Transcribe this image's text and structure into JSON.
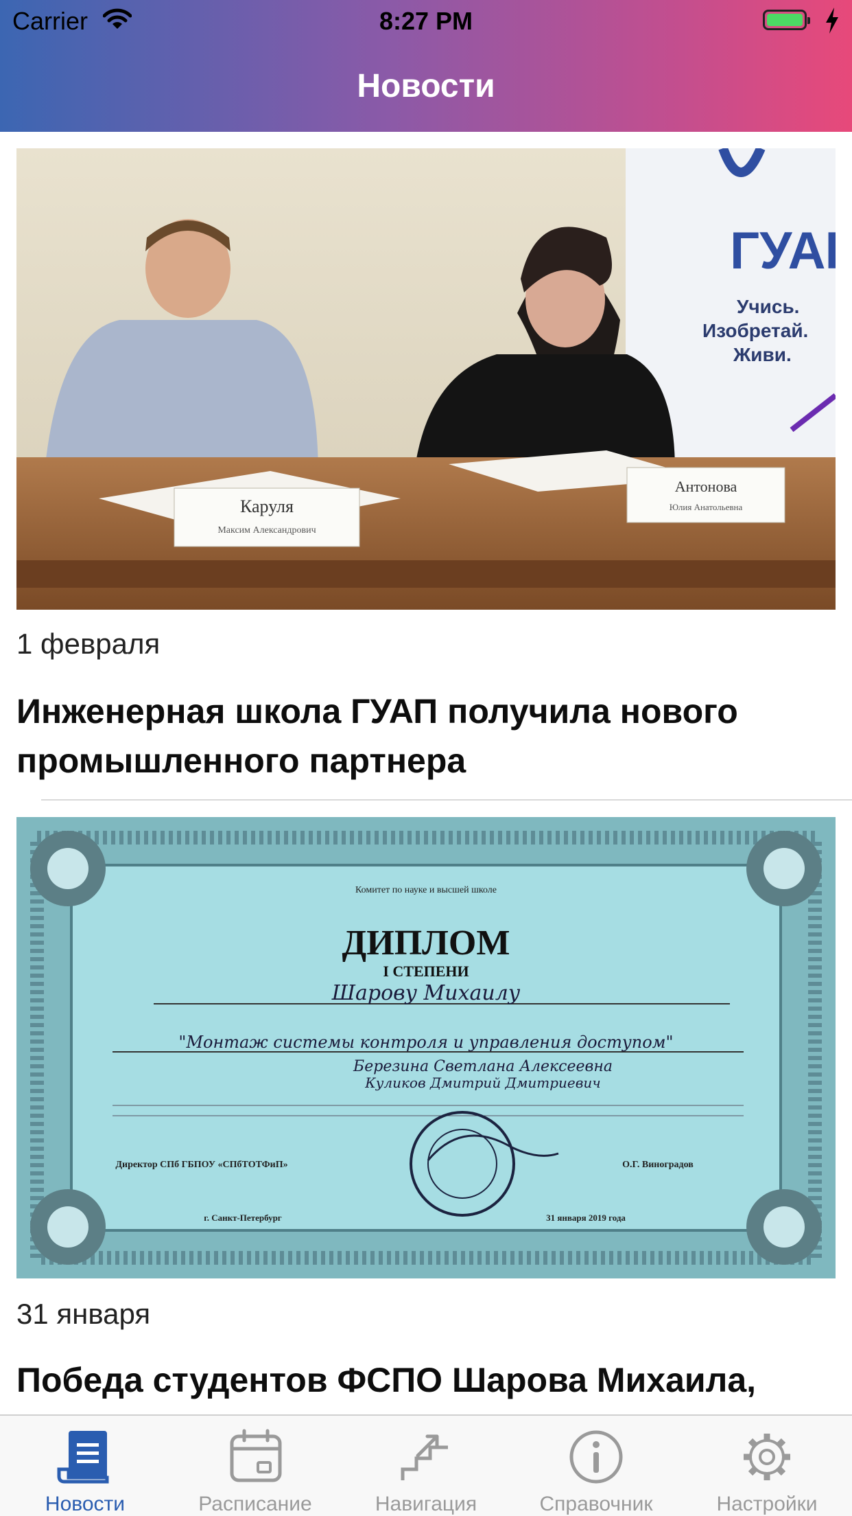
{
  "status_bar": {
    "carrier": "Carrier",
    "time": "8:27 PM"
  },
  "nav": {
    "title": "Новости"
  },
  "news": [
    {
      "date": "1 февраля",
      "title": "Инженерная школа ГУАП получила нового промышленного партнера",
      "image_text": {
        "logo": "ГУАП",
        "slogan": [
          "Учись.",
          "Изобретай.",
          "Живи."
        ],
        "nameplate_left": "Каруля",
        "nameplate_left_sub": "Максим Александрович",
        "nameplate_right": "Антонова",
        "nameplate_right_sub": "Юлия Анатольевна"
      }
    },
    {
      "date": "31 января",
      "title": "Победа студентов ФСПО Шарова Михаила,",
      "image_text": {
        "issuer": "Комитет по науке и высшей школе",
        "heading": "ДИПЛОМ",
        "degree": "I СТЕПЕНИ",
        "recipient": "Шарову Михаилу",
        "topic": "\"Монтаж системы контроля и управления доступом\"",
        "supervisor_1": "Березина Светлана Алексеевна",
        "supervisor_2": "Куликов Дмитрий Дмитриевич",
        "director_line": "Директор СПб ГБПОУ «СПбТОТФиП»",
        "director_name": "О.Г. Виноградов",
        "city": "г. Санкт-Петербург",
        "date": "31 января 2019 года"
      }
    }
  ],
  "tabs": [
    {
      "label": "Новости",
      "icon": "news-icon",
      "active": true
    },
    {
      "label": "Расписание",
      "icon": "calendar-icon",
      "active": false
    },
    {
      "label": "Навигация",
      "icon": "stairs-icon",
      "active": false
    },
    {
      "label": "Справочник",
      "icon": "info-icon",
      "active": false
    },
    {
      "label": "Настройки",
      "icon": "gear-icon",
      "active": false
    }
  ],
  "colors": {
    "header_gradient_start": "#3c66b2",
    "header_gradient_end": "#e7497a",
    "tab_active": "#2a5db0",
    "tab_inactive": "#9a9a9a"
  }
}
